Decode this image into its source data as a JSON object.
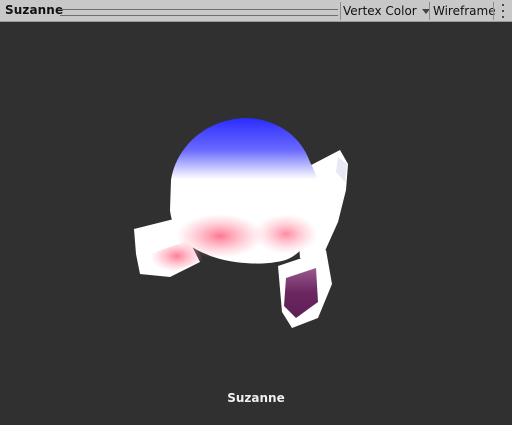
{
  "toolbar": {
    "title": "Suzanne",
    "shading_mode": "Vertex Color",
    "wireframe_label": "Wireframe"
  },
  "viewport": {
    "object_label": "Suzanne",
    "colors": {
      "background": "#303030",
      "vertex_blue": "#2b2bff",
      "vertex_pink": "#ff7a94",
      "vertex_purple": "#6b2660",
      "vertex_white": "#ffffff"
    }
  }
}
